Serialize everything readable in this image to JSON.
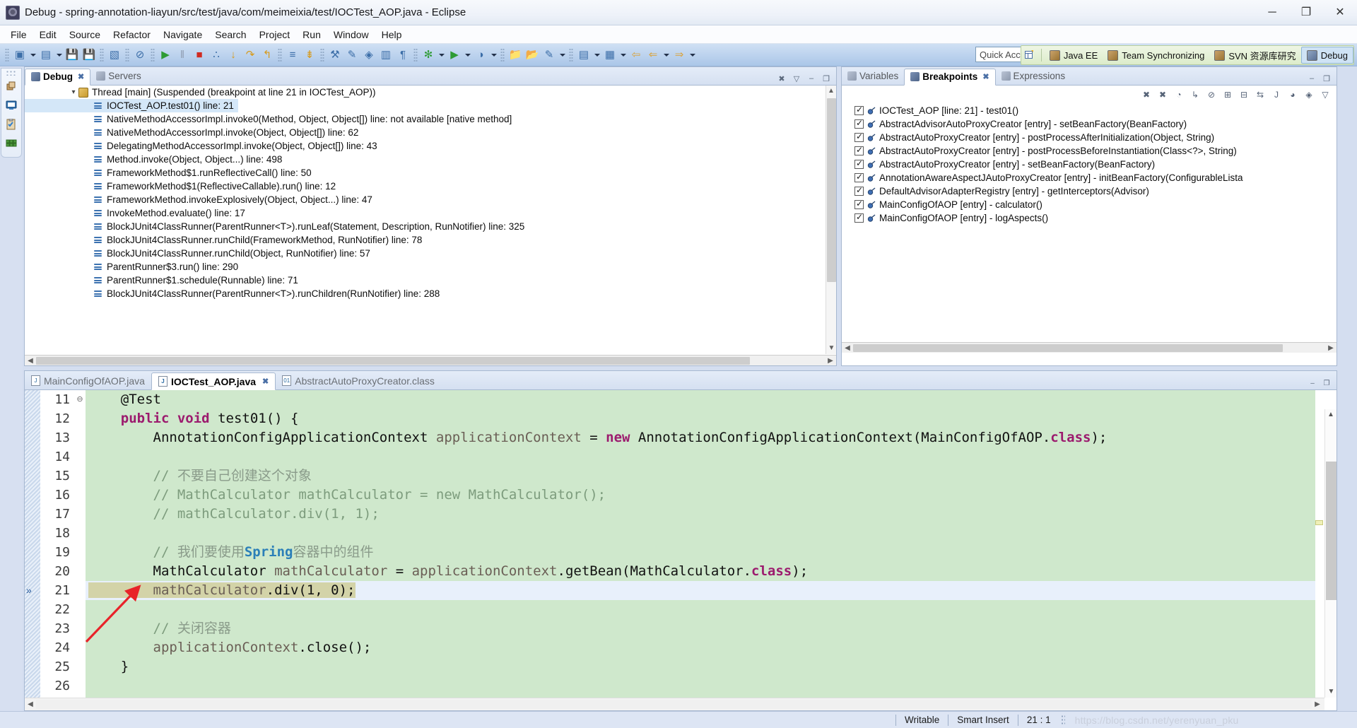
{
  "window": {
    "title": "Debug - spring-annotation-liayun/src/test/java/com/meimeixia/test/IOCTest_AOP.java - Eclipse",
    "icon": "eclipse-icon",
    "minimize": "─",
    "maximize": "❐",
    "close": "✕"
  },
  "menubar": {
    "items": [
      "File",
      "Edit",
      "Source",
      "Refactor",
      "Navigate",
      "Search",
      "Project",
      "Run",
      "Window",
      "Help"
    ]
  },
  "toolbar": {
    "quick_access_placeholder": "Quick Access",
    "groups": [
      {
        "items": [
          {
            "name": "new-wizard-icon",
            "glyph": "▣"
          },
          {
            "name": "new-dropdown-arrow",
            "glyph": "▼"
          },
          {
            "name": "new-java-class-icon",
            "glyph": "▤"
          },
          {
            "name": "new-java-dropdown-arrow",
            "glyph": "▼"
          },
          {
            "name": "save-icon",
            "glyph": "💾"
          },
          {
            "name": "save-all-icon",
            "glyph": "💾"
          }
        ]
      },
      {
        "items": [
          {
            "name": "console-icon",
            "glyph": "▧"
          }
        ]
      },
      {
        "items": [
          {
            "name": "skip-all-breakpoints-icon",
            "glyph": "⊘"
          }
        ]
      },
      {
        "items": [
          {
            "name": "resume-icon",
            "glyph": "▶"
          },
          {
            "name": "suspend-icon",
            "glyph": "‖"
          },
          {
            "name": "terminate-icon",
            "glyph": "■"
          },
          {
            "name": "disconnect-icon",
            "glyph": "∴"
          },
          {
            "name": "step-into-icon",
            "glyph": "↓"
          },
          {
            "name": "step-over-icon",
            "glyph": "↷"
          },
          {
            "name": "step-return-icon",
            "glyph": "↰"
          }
        ]
      },
      {
        "items": [
          {
            "name": "drop-to-frame-icon",
            "glyph": "≡"
          },
          {
            "name": "use-step-filters-icon",
            "glyph": "⇟"
          }
        ]
      },
      {
        "items": [
          {
            "name": "new-java-project-icon",
            "glyph": "⚒"
          },
          {
            "name": "new-annotation-icon",
            "glyph": "✎"
          },
          {
            "name": "new-package-icon",
            "glyph": "◈"
          },
          {
            "name": "open-type-icon",
            "glyph": "▥"
          },
          {
            "name": "open-task-icon",
            "glyph": "¶"
          }
        ]
      },
      {
        "items": [
          {
            "name": "debug-run-icon",
            "glyph": "✻"
          },
          {
            "name": "debug-dropdown-arrow",
            "glyph": "▼"
          },
          {
            "name": "run-icon",
            "glyph": "▶"
          },
          {
            "name": "run-dropdown-arrow",
            "glyph": "▼"
          },
          {
            "name": "coverage-icon",
            "glyph": "◑"
          },
          {
            "name": "coverage-dropdown-arrow",
            "glyph": "▼"
          }
        ]
      },
      {
        "items": [
          {
            "name": "open-folder-icon",
            "glyph": "📁"
          },
          {
            "name": "external-tools-icon",
            "glyph": "📂"
          },
          {
            "name": "pencil-icon",
            "glyph": "✎"
          },
          {
            "name": "pencil-dropdown-arrow",
            "glyph": "▼"
          }
        ]
      },
      {
        "items": [
          {
            "name": "previous-annotation-icon",
            "glyph": "▤"
          },
          {
            "name": "previous-annotation-arrow",
            "glyph": "▼"
          },
          {
            "name": "next-annotation-icon",
            "glyph": "▦"
          },
          {
            "name": "next-annotation-arrow",
            "glyph": "▼"
          },
          {
            "name": "back-icon",
            "glyph": "⇦"
          },
          {
            "name": "back-history-icon",
            "glyph": "⇐"
          },
          {
            "name": "back-dropdown-arrow",
            "glyph": "▼"
          },
          {
            "name": "forward-icon",
            "glyph": "⇒"
          },
          {
            "name": "forward-dropdown-arrow",
            "glyph": "▼"
          }
        ]
      }
    ]
  },
  "perspectives": {
    "open_perspective_icon": "open-perspective-icon",
    "items": [
      {
        "label": "Java EE",
        "icon": "java-ee-icon",
        "active": false
      },
      {
        "label": "Team Synchronizing",
        "icon": "team-sync-icon",
        "active": false
      },
      {
        "label": "SVN 资源库研究",
        "icon": "svn-icon",
        "active": false
      },
      {
        "label": "Debug",
        "icon": "debug-perspective-icon",
        "active": true
      }
    ]
  },
  "left_rail": {
    "items": [
      {
        "name": "restore-icon",
        "glyph": "❐"
      },
      {
        "name": "console-view-icon",
        "glyph": "▧"
      },
      {
        "name": "tasks-view-icon",
        "glyph": "☑"
      },
      {
        "name": "servers-view-icon",
        "glyph": "▒"
      }
    ]
  },
  "debug_panel": {
    "tabs": [
      {
        "label": "Debug",
        "icon": "debug-icon",
        "active": true,
        "closeable": true
      },
      {
        "label": "Servers",
        "icon": "servers-icon",
        "active": false,
        "closeable": false
      }
    ],
    "view_tools": [
      {
        "name": "remove-all-terminated-icon",
        "glyph": "✖"
      },
      {
        "name": "view-menu-icon",
        "glyph": "▽"
      },
      {
        "name": "minimize-icon",
        "glyph": "–"
      },
      {
        "name": "maximize-icon",
        "glyph": "❐"
      }
    ],
    "thread_label": "Thread [main] (Suspended (breakpoint at line 21 in IOCTest_AOP))",
    "stack_frames": [
      {
        "text": "IOCTest_AOP.test01() line: 21",
        "selected": true
      },
      {
        "text": "NativeMethodAccessorImpl.invoke0(Method, Object, Object[]) line: not available [native method]",
        "selected": false
      },
      {
        "text": "NativeMethodAccessorImpl.invoke(Object, Object[]) line: 62",
        "selected": false
      },
      {
        "text": "DelegatingMethodAccessorImpl.invoke(Object, Object[]) line: 43",
        "selected": false
      },
      {
        "text": "Method.invoke(Object, Object...) line: 498",
        "selected": false
      },
      {
        "text": "FrameworkMethod$1.runReflectiveCall() line: 50",
        "selected": false
      },
      {
        "text": "FrameworkMethod$1(ReflectiveCallable).run() line: 12",
        "selected": false
      },
      {
        "text": "FrameworkMethod.invokeExplosively(Object, Object...) line: 47",
        "selected": false
      },
      {
        "text": "InvokeMethod.evaluate() line: 17",
        "selected": false
      },
      {
        "text": "BlockJUnit4ClassRunner(ParentRunner<T>).runLeaf(Statement, Description, RunNotifier) line: 325",
        "selected": false
      },
      {
        "text": "BlockJUnit4ClassRunner.runChild(FrameworkMethod, RunNotifier) line: 78",
        "selected": false
      },
      {
        "text": "BlockJUnit4ClassRunner.runChild(Object, RunNotifier) line: 57",
        "selected": false
      },
      {
        "text": "ParentRunner$3.run() line: 290",
        "selected": false
      },
      {
        "text": "ParentRunner$1.schedule(Runnable) line: 71",
        "selected": false
      },
      {
        "text": "BlockJUnit4ClassRunner(ParentRunner<T>).runChildren(RunNotifier) line: 288",
        "selected": false
      }
    ]
  },
  "breakpoints_panel": {
    "tabs": [
      {
        "label": "Variables",
        "icon": "variables-icon",
        "active": false,
        "closeable": false
      },
      {
        "label": "Breakpoints",
        "icon": "breakpoints-icon",
        "active": true,
        "closeable": true
      },
      {
        "label": "Expressions",
        "icon": "expressions-icon",
        "active": false,
        "closeable": false
      }
    ],
    "view_tools": [
      {
        "name": "remove-breakpoint-icon",
        "glyph": "✖"
      },
      {
        "name": "remove-all-breakpoints-icon",
        "glyph": "✖"
      },
      {
        "name": "show-breakpoints-supported-icon",
        "glyph": "◔"
      },
      {
        "name": "go-to-file-icon",
        "glyph": "↳"
      },
      {
        "name": "skip-all-breakpoints-icon",
        "glyph": "⊘"
      },
      {
        "name": "expand-all-icon",
        "glyph": "⊞"
      },
      {
        "name": "collapse-all-icon",
        "glyph": "⊟"
      },
      {
        "name": "link-with-debug-view-icon",
        "glyph": "⇆"
      },
      {
        "name": "add-java-exception-breakpoint-icon",
        "glyph": "J"
      },
      {
        "name": "working-sets-icon",
        "glyph": "◕"
      },
      {
        "name": "breakpoint-types-icon",
        "glyph": "◈"
      },
      {
        "name": "view-menu-icon",
        "glyph": "▽"
      }
    ],
    "panel_tools": [
      {
        "name": "minimize-icon",
        "glyph": "–"
      },
      {
        "name": "maximize-icon",
        "glyph": "❐"
      }
    ],
    "items": [
      {
        "text": "IOCTest_AOP [line: 21] - test01()",
        "checked": true
      },
      {
        "text": "AbstractAdvisorAutoProxyCreator [entry] - setBeanFactory(BeanFactory)",
        "checked": true
      },
      {
        "text": "AbstractAutoProxyCreator [entry] - postProcessAfterInitialization(Object, String)",
        "checked": true
      },
      {
        "text": "AbstractAutoProxyCreator [entry] - postProcessBeforeInstantiation(Class<?>, String)",
        "checked": true
      },
      {
        "text": "AbstractAutoProxyCreator [entry] - setBeanFactory(BeanFactory)",
        "checked": true
      },
      {
        "text": "AnnotationAwareAspectJAutoProxyCreator [entry] - initBeanFactory(ConfigurableLista",
        "checked": true
      },
      {
        "text": "DefaultAdvisorAdapterRegistry [entry] - getInterceptors(Advisor)",
        "checked": true
      },
      {
        "text": "MainConfigOfAOP [entry] - calculator()",
        "checked": true
      },
      {
        "text": "MainConfigOfAOP [entry] - logAspects()",
        "checked": true
      }
    ]
  },
  "editor": {
    "tabs": [
      {
        "label": "MainConfigOfAOP.java",
        "icon": "java-file-icon",
        "active": false,
        "closeable": false
      },
      {
        "label": "IOCTest_AOP.java",
        "icon": "java-file-icon",
        "active": true,
        "closeable": true
      },
      {
        "label": "AbstractAutoProxyCreator.class",
        "icon": "class-file-icon",
        "active": false,
        "closeable": false
      }
    ],
    "panel_tools": [
      {
        "name": "minimize-icon",
        "glyph": "–"
      },
      {
        "name": "maximize-icon",
        "glyph": "❐"
      }
    ],
    "lines": [
      {
        "num": "11",
        "fold": "⊖",
        "current": false,
        "tokens": [
          {
            "t": "    ",
            "c": "plain"
          },
          {
            "t": "@Test",
            "c": "plain"
          }
        ]
      },
      {
        "num": "12",
        "fold": "",
        "current": false,
        "tokens": [
          {
            "t": "    ",
            "c": "plain"
          },
          {
            "t": "public",
            "c": "kw"
          },
          {
            "t": " ",
            "c": "plain"
          },
          {
            "t": "void",
            "c": "kw"
          },
          {
            "t": " test01() {",
            "c": "plain"
          }
        ]
      },
      {
        "num": "13",
        "fold": "",
        "current": false,
        "tokens": [
          {
            "t": "        AnnotationConfigApplicationContext ",
            "c": "plain"
          },
          {
            "t": "applicationContext",
            "c": "vr"
          },
          {
            "t": " = ",
            "c": "plain"
          },
          {
            "t": "new",
            "c": "kw"
          },
          {
            "t": " AnnotationConfigApplicationContext(MainConfigOfAOP.",
            "c": "plain"
          },
          {
            "t": "class",
            "c": "kw"
          },
          {
            "t": ");",
            "c": "plain"
          }
        ]
      },
      {
        "num": "14",
        "fold": "",
        "current": false,
        "tokens": [
          {
            "t": "",
            "c": "plain"
          }
        ]
      },
      {
        "num": "15",
        "fold": "",
        "current": false,
        "tokens": [
          {
            "t": "        // ",
            "c": "cm"
          },
          {
            "t": "不要自己创建这个对象",
            "c": "cmz"
          }
        ]
      },
      {
        "num": "16",
        "fold": "",
        "current": false,
        "tokens": [
          {
            "t": "        // MathCalculator mathCalculator = new MathCalculator();",
            "c": "cm"
          }
        ]
      },
      {
        "num": "17",
        "fold": "",
        "current": false,
        "tokens": [
          {
            "t": "        // mathCalculator.div(1, 1);",
            "c": "cm"
          }
        ]
      },
      {
        "num": "18",
        "fold": "",
        "current": false,
        "tokens": [
          {
            "t": "",
            "c": "plain"
          }
        ]
      },
      {
        "num": "19",
        "fold": "",
        "current": false,
        "tokens": [
          {
            "t": "        // ",
            "c": "cm"
          },
          {
            "t": "我们要使用",
            "c": "cmz"
          },
          {
            "t": "Spring",
            "c": "cmb"
          },
          {
            "t": "容器中的组件",
            "c": "cmz"
          }
        ]
      },
      {
        "num": "20",
        "fold": "",
        "current": false,
        "tokens": [
          {
            "t": "        MathCalculator ",
            "c": "plain"
          },
          {
            "t": "mathCalculator",
            "c": "vr"
          },
          {
            "t": " = ",
            "c": "plain"
          },
          {
            "t": "applicationContext",
            "c": "vr"
          },
          {
            "t": ".getBean(MathCalculator.",
            "c": "plain"
          },
          {
            "t": "class",
            "c": "kw"
          },
          {
            "t": ");",
            "c": "plain"
          }
        ]
      },
      {
        "num": "21",
        "fold": "",
        "current": true,
        "tokens": [
          {
            "t": "        ",
            "c": "plain"
          },
          {
            "t": "mathCalculator",
            "c": "vr"
          },
          {
            "t": ".div(1, 0);",
            "c": "plain"
          }
        ]
      },
      {
        "num": "22",
        "fold": "",
        "current": false,
        "tokens": [
          {
            "t": "",
            "c": "plain"
          }
        ]
      },
      {
        "num": "23",
        "fold": "",
        "current": false,
        "tokens": [
          {
            "t": "        // ",
            "c": "cm"
          },
          {
            "t": "关闭容器",
            "c": "cmz"
          }
        ]
      },
      {
        "num": "24",
        "fold": "",
        "current": false,
        "tokens": [
          {
            "t": "        ",
            "c": "plain"
          },
          {
            "t": "applicationContext",
            "c": "vr"
          },
          {
            "t": ".close();",
            "c": "plain"
          }
        ]
      },
      {
        "num": "25",
        "fold": "",
        "current": false,
        "tokens": [
          {
            "t": "    }",
            "c": "plain"
          }
        ]
      },
      {
        "num": "26",
        "fold": "",
        "current": false,
        "tokens": [
          {
            "t": "",
            "c": "plain"
          }
        ]
      }
    ]
  },
  "statusbar": {
    "writable": "Writable",
    "insert_mode": "Smart Insert",
    "cursor_position": "21 : 1",
    "watermark": "https://blog.csdn.net/yerenyuan_pku"
  },
  "colors": {
    "code_background": "#cfe8cc",
    "current_line": "#e8f0fb",
    "current_line_highlight": "#d3d3a8",
    "keyword": "#9c1b6e",
    "comment": "#7d9c7d",
    "selection": "#d4e7f8",
    "annotation_arrow": "#e8232a"
  }
}
